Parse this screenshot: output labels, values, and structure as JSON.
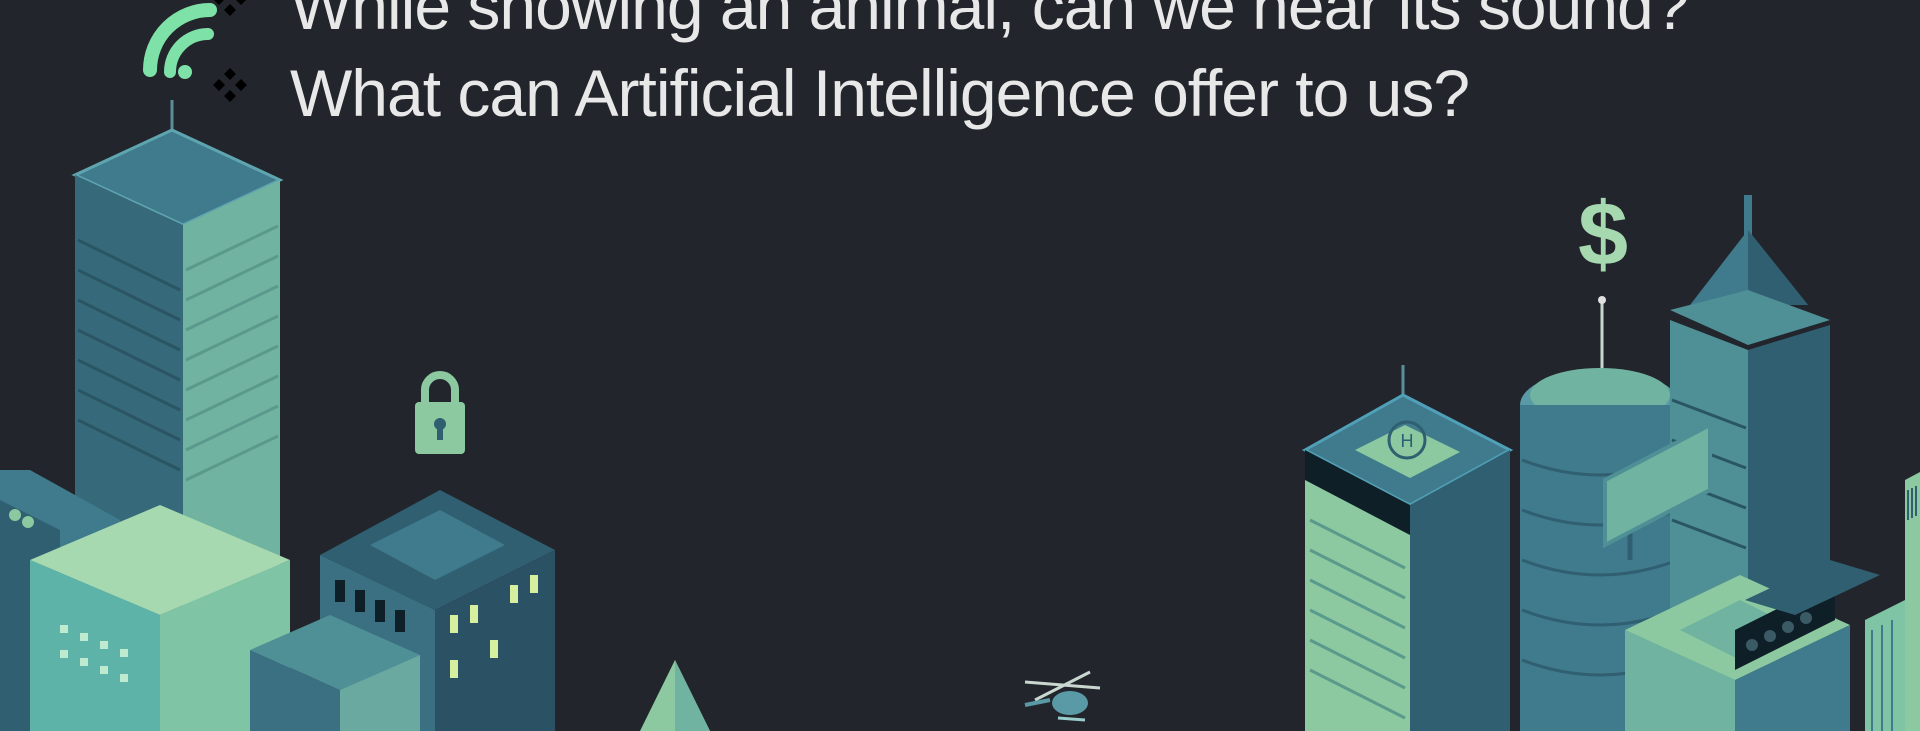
{
  "slide": {
    "bullets": [
      "While showing an animal, can we hear its sound?",
      "What can Artificial Intelligence offer to us?"
    ]
  },
  "colors": {
    "background": "#22252c",
    "text": "#e8e8e8",
    "building_teal": "#3f7b8c",
    "building_dark": "#2f5f70",
    "building_mint": "#8cc9a0",
    "building_light": "#a6d9b0",
    "accent_green": "#7ee2a8"
  },
  "icons": [
    "wifi-icon",
    "lock-icon",
    "dollar-icon",
    "helicopter-icon",
    "helipad-icon",
    "billboard-icon"
  ]
}
